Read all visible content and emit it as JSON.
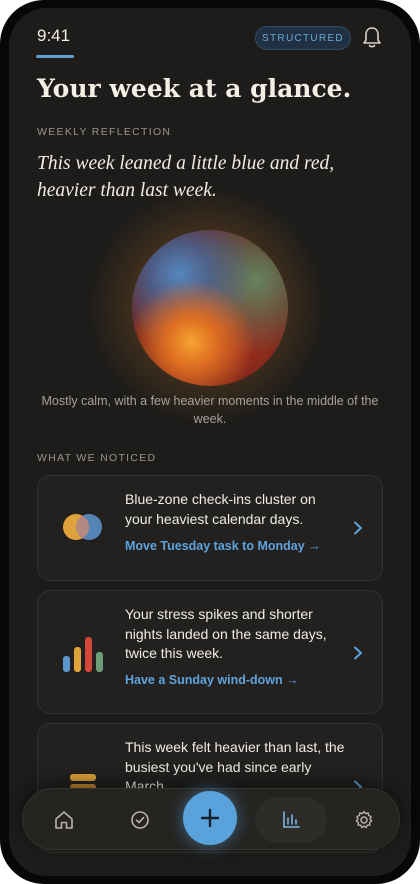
{
  "status_bar": {
    "time": "9:41",
    "mode_badge": "STRUCTURED",
    "notification_icon": "bell-icon"
  },
  "header": {
    "title": "Your week at a glance."
  },
  "reflection": {
    "label": "WEEKLY REFLECTION",
    "quote": "This week leaned a little blue and red, heavier than last week.",
    "caption": "Mostly calm, with a few heavier moments in the middle of the week."
  },
  "noticed": {
    "label": "WHAT WE NOTICED",
    "cards": [
      {
        "icon": "overlapping-circles-icon",
        "text": "Blue-zone check-ins cluster on your heaviest calendar days.",
        "action": "Move Tuesday task to Monday →"
      },
      {
        "icon": "bar-chart-icon",
        "text": "Your stress spikes and shorter nights landed on the same days, twice this week.",
        "action": "Have a Sunday wind-down →"
      },
      {
        "icon": "stack-icon",
        "text": "This week felt heavier than last, the busiest you've had since early March.",
        "action": ""
      }
    ]
  },
  "nav": {
    "items": [
      "home-icon",
      "check-circle-icon",
      "plus-icon",
      "insights-chart-icon",
      "settings-gear-icon"
    ],
    "active": "insights-chart-icon"
  },
  "colors": {
    "accent": "#5aa2dc",
    "background": "#1d1c1a",
    "card": "#222120"
  }
}
